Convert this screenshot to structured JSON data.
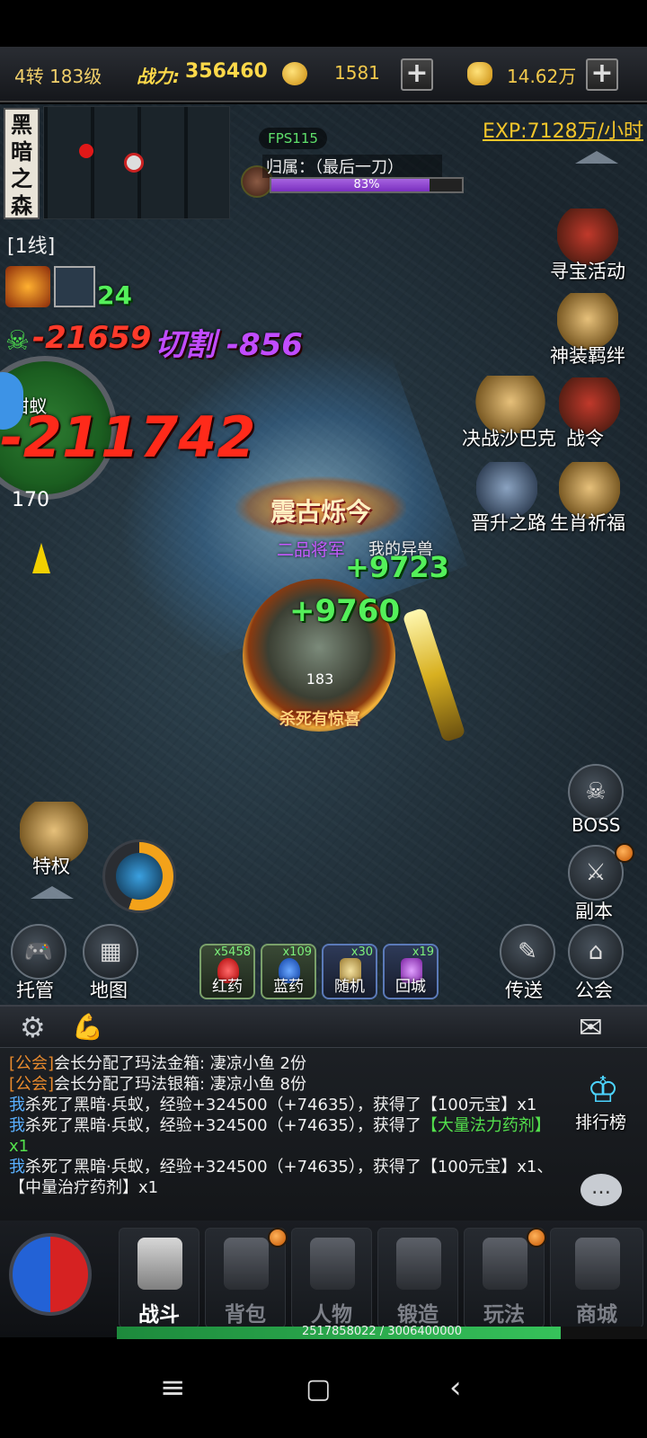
{
  "topbar": {
    "rank": "4转 183级",
    "power_label": "战力:",
    "power_value": "356460",
    "gold": "1581",
    "ingot": "14.62万"
  },
  "map": {
    "name": "黑暗之森",
    "line": "[1线]"
  },
  "target": {
    "fps": "FPS115",
    "owner": "归属：（最后一刀）",
    "hp_percent": 83,
    "hp_text": "83%"
  },
  "exp_rate": "EXP:7128万/小时",
  "combat": {
    "buff_count": "24",
    "damage_1": "-21659",
    "damage_1_tag": "切割 -856",
    "damage_2": "-211742",
    "heal_1": "+9723",
    "heal_2": "+9760",
    "radar_level": "170",
    "radar_tag": "·钳蚁",
    "badge_title": "震古烁今",
    "rank_name": "二品将军",
    "pet_name": "我的异兽",
    "hero_level": "183",
    "hero_banner": "杀死有惊喜"
  },
  "right_menu": {
    "treasure": "寻宝活动",
    "divine": "神装羁绊",
    "sabac": "决战沙巴克",
    "battle_order": "战令",
    "promotion": "晋升之路",
    "zodiac": "生肖祈福",
    "boss": "BOSS",
    "dungeon": "副本",
    "teleport": "传送",
    "guild": "公会"
  },
  "left_menu": {
    "privilege": "特权",
    "auto": "托管",
    "map": "地图"
  },
  "quick_items": [
    {
      "name": "红药",
      "count": "x5458"
    },
    {
      "name": "蓝药",
      "count": "x109"
    },
    {
      "name": "随机",
      "count": "x30"
    },
    {
      "name": "回城",
      "count": "x19"
    }
  ],
  "chat": {
    "ranking": "排行榜",
    "lines": [
      {
        "tag": "[公会]",
        "text": "会长分配了玛法金箱: 凄凉小鱼 2份"
      },
      {
        "tag": "[公会]",
        "text": "会长分配了玛法银箱: 凄凉小鱼 8份"
      },
      {
        "who": "我",
        "text": "杀死了黑暗·兵蚁，经验+324500（+74635），获得了【100元宝】x1"
      },
      {
        "who": "我",
        "text": "杀死了黑暗·兵蚁，经验+324500（+74635），获得了",
        "item": "【大量法力药剂】x1"
      },
      {
        "who": "我",
        "text": "杀死了黑暗·兵蚁，经验+324500（+74635），获得了【100元宝】x1、【中量治疗药剂】x1"
      }
    ]
  },
  "bottom_nav": [
    "战斗",
    "背包",
    "人物",
    "锻造",
    "玩法",
    "商城"
  ],
  "exp_bar": {
    "text": "2517858022 / 3006400000",
    "progress": 0.8375
  }
}
